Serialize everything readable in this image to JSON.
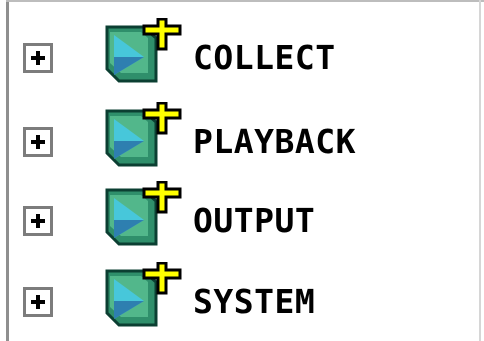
{
  "tree": {
    "nodes": [
      {
        "label": "COLLECT",
        "icon": "folder-add-icon",
        "expanded": false
      },
      {
        "label": "PLAYBACK",
        "icon": "folder-add-icon",
        "expanded": false
      },
      {
        "label": "OUTPUT",
        "icon": "folder-add-icon",
        "expanded": false
      },
      {
        "label": "SYSTEM",
        "icon": "folder-add-icon",
        "expanded": false
      }
    ]
  },
  "colors": {
    "icon_green": "#2f8f6b",
    "icon_dark": "#0b3f32",
    "icon_blue": "#2e7fb0",
    "icon_cyan": "#47c7da",
    "plus_yellow": "#ffff00",
    "frame_gray": "#8f8f8f"
  }
}
